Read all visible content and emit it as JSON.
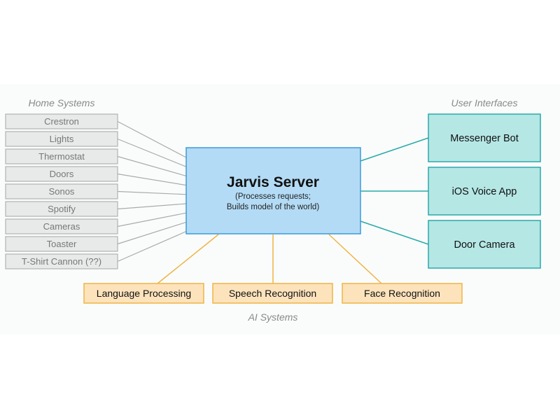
{
  "groups": {
    "home": {
      "label": "Home Systems",
      "items": [
        "Crestron",
        "Lights",
        "Thermostat",
        "Doors",
        "Sonos",
        "Spotify",
        "Cameras",
        "Toaster",
        "T-Shirt Cannon (??)"
      ]
    },
    "ui": {
      "label": "User Interfaces",
      "items": [
        "Messenger Bot",
        "iOS Voice App",
        "Door Camera"
      ]
    },
    "ai": {
      "label": "AI Systems",
      "items": [
        "Language Processing",
        "Speech Recognition",
        "Face Recognition"
      ]
    }
  },
  "server": {
    "title": "Jarvis Server",
    "line1": "(Processes requests;",
    "line2": "Builds model of the world)"
  },
  "colors": {
    "home_fill": "#e8eaea",
    "home_stroke": "#b0b3b3",
    "home_text": "#777777",
    "server_fill": "#b3dbf5",
    "server_stroke": "#3b9bd8",
    "ui_fill": "#b5e7e5",
    "ui_stroke": "#2aaaa8",
    "ai_fill": "#fde3bc",
    "ai_stroke": "#f0b444"
  }
}
